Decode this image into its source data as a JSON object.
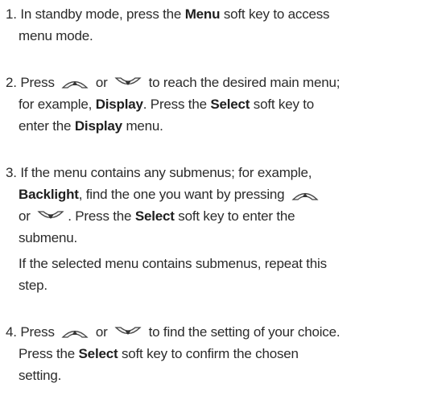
{
  "steps": [
    {
      "number": "1.",
      "text_a": "In standby mode, press the",
      "bold_a": "Menu",
      "text_b": "soft key to access",
      "line2": "menu mode."
    },
    {
      "number": "2.",
      "press": "Press",
      "or": "or",
      "text_a": "to reach the desired main menu;",
      "text_b": "for example,",
      "bold_a": "Display",
      "text_c": ". Press the",
      "bold_b": "Select",
      "text_d": "soft key to",
      "text_e": "enter the",
      "bold_c": "Display",
      "text_f": "menu."
    },
    {
      "number": "3.",
      "text_a": "If the menu contains any submenus; for example,",
      "bold_a": "Backlight",
      "text_b": ", find the one you want by pressing",
      "or": "or",
      "text_c": ". Press the",
      "bold_b": "Select",
      "text_d": "soft key to enter the",
      "text_e": "submenu."
    },
    {
      "number": "4.",
      "press": "Press",
      "or": "or",
      "text_a": "to find the setting of your choice.",
      "text_b": "Press the",
      "bold_a": "Select",
      "text_c": "soft key to confirm the chosen",
      "text_d": "setting."
    }
  ],
  "note": {
    "line1": "If the selected menu contains submenus, repeat this",
    "line2": "step."
  },
  "icons": {
    "up": "nav-up-key-icon",
    "down": "nav-down-key-icon"
  }
}
